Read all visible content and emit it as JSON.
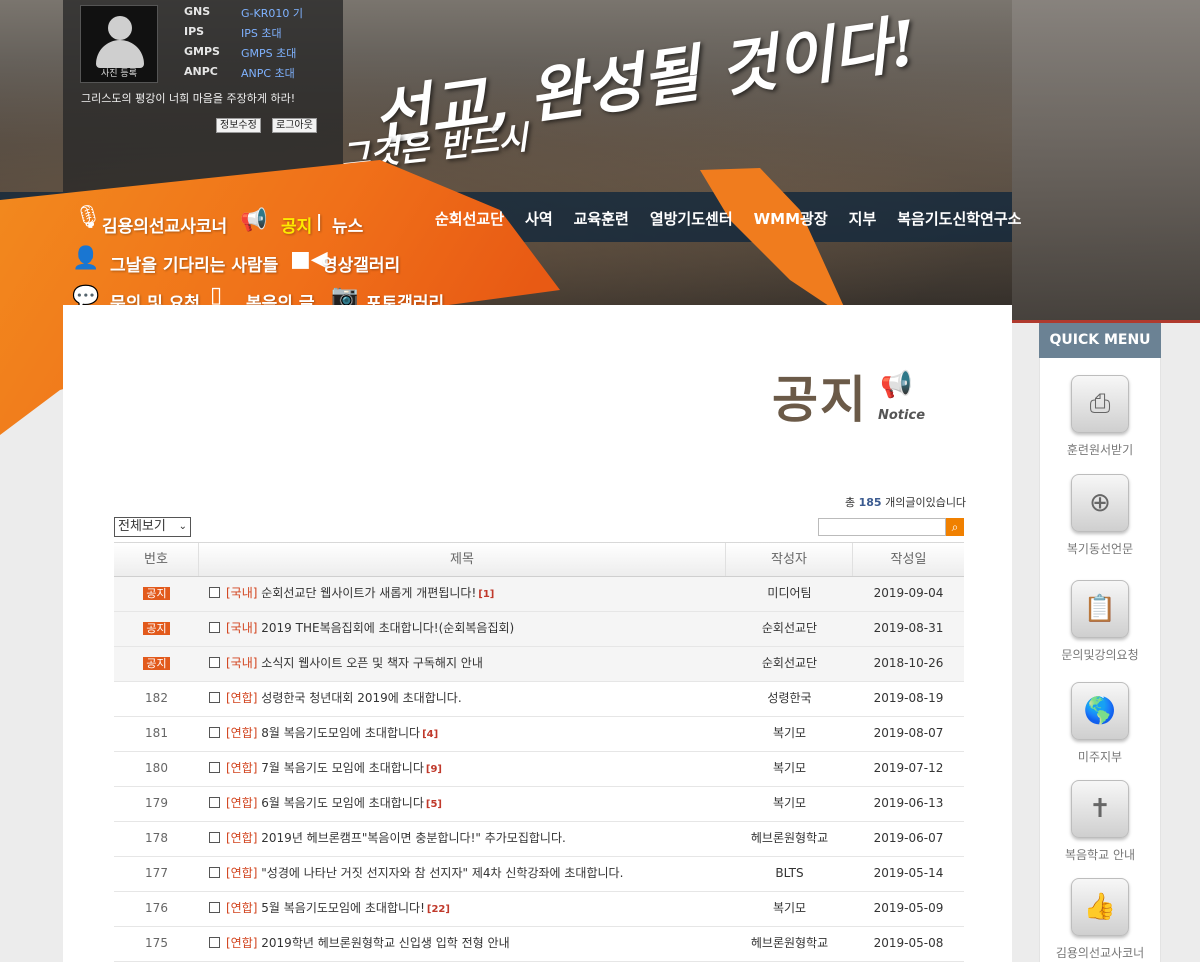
{
  "login": {
    "photo_caption": "사진 등록",
    "rows": [
      {
        "label": "GNS",
        "value": "G-KR010 기"
      },
      {
        "label": "IPS",
        "value": "IPS 초대"
      },
      {
        "label": "GMPS",
        "value": "GMPS 초대"
      },
      {
        "label": "ANPC",
        "value": "ANPC 초대"
      }
    ],
    "motto": "그리스도의 평강이 너희 마음을 주장하게 하라!",
    "edit_label": "정보수정",
    "logout_label": "로그아웃"
  },
  "slogan": {
    "line1": "선교, 완성될 것이다!",
    "line2": "그것은 반드시"
  },
  "nav": [
    "순회선교단",
    "사역",
    "교육훈련",
    "열방기도센터",
    "WMM광장",
    "지부",
    "복음기도신학연구소"
  ],
  "quicklinks": {
    "missionary_corner": "김용의선교사코너",
    "notice": "공지",
    "separator": "|",
    "news": "뉴스",
    "waiting_people": "그날을 기다리는 사람들",
    "video_gallery": "영상갤러리",
    "inquiry": "문의 및 요청",
    "gospel_writing": "복음의 글",
    "photo_gallery": "포토갤러리"
  },
  "page_title": {
    "ko": "공지",
    "en": "Notice"
  },
  "count": {
    "prefix": "총",
    "value": "185",
    "suffix": "개의글이있습니다"
  },
  "filter": {
    "selected": "전체보기"
  },
  "table": {
    "headers": [
      "번호",
      "제목",
      "작성자",
      "작성일"
    ],
    "rows": [
      {
        "num": "공지",
        "notice": true,
        "cat": "[국내]",
        "title": "순회선교단 웹사이트가 새롭게 개편됩니다!",
        "comments": "[1]",
        "author": "미디어팀",
        "date": "2019-09-04"
      },
      {
        "num": "공지",
        "notice": true,
        "cat": "[국내]",
        "title": "2019 THE복음집회에 초대합니다!(순회복음집회)",
        "comments": "",
        "author": "순회선교단",
        "date": "2019-08-31"
      },
      {
        "num": "공지",
        "notice": true,
        "cat": "[국내]",
        "title": "소식지 웹사이트 오픈 및 책자 구독해지 안내",
        "comments": "",
        "author": "순회선교단",
        "date": "2018-10-26"
      },
      {
        "num": "182",
        "notice": false,
        "cat": "[연합]",
        "title": "성령한국 청년대회 2019에 초대합니다.",
        "comments": "",
        "author": "성령한국",
        "date": "2019-08-19"
      },
      {
        "num": "181",
        "notice": false,
        "cat": "[연합]",
        "title": "8월 복음기도모임에 초대합니다",
        "comments": "[4]",
        "author": "복기모",
        "date": "2019-08-07"
      },
      {
        "num": "180",
        "notice": false,
        "cat": "[연합]",
        "title": "7월 복음기도 모임에 초대합니다",
        "comments": "[9]",
        "author": "복기모",
        "date": "2019-07-12"
      },
      {
        "num": "179",
        "notice": false,
        "cat": "[연합]",
        "title": "6월 복음기도 모임에 초대합니다",
        "comments": "[5]",
        "author": "복기모",
        "date": "2019-06-13"
      },
      {
        "num": "178",
        "notice": false,
        "cat": "[연합]",
        "title": "2019년 헤브론캠프\"복음이면 충분합니다!\" 추가모집합니다.",
        "comments": "",
        "author": "헤브론원형학교",
        "date": "2019-06-07"
      },
      {
        "num": "177",
        "notice": false,
        "cat": "[연합]",
        "title": "\"성경에 나타난 거짓 선지자와 참 선지자\" 제4차 신학강좌에 초대합니다.",
        "comments": "",
        "author": "BLTS",
        "date": "2019-05-14"
      },
      {
        "num": "176",
        "notice": false,
        "cat": "[연합]",
        "title": "5월 복음기도모임에 초대합니다!",
        "comments": "[22]",
        "author": "복기모",
        "date": "2019-05-09"
      },
      {
        "num": "175",
        "notice": false,
        "cat": "[연합]",
        "title": "2019학년 헤브론원형학교 신입생 입학 전형 안내",
        "comments": "",
        "author": "헤브론원형학교",
        "date": "2019-05-08"
      }
    ]
  },
  "quick_menu": {
    "title": "QUICK MENU",
    "items": [
      {
        "label": "훈련원서받기",
        "icon": "fax-icon"
      },
      {
        "label": "복기동선언문",
        "icon": "steering-wheel-icon"
      },
      {
        "label": "문의및강의요청",
        "icon": "clipboard-icon"
      },
      {
        "label": "미주지부",
        "icon": "globe-icon"
      },
      {
        "label": "복음학교 안내",
        "icon": "cross-icon"
      },
      {
        "label": "김용의선교사코너",
        "icon": "thumbs-up-icon"
      }
    ]
  },
  "colors": {
    "accent_orange": "#f07c1e",
    "notice_badge": "#e25a1c",
    "category_red": "#d2441e",
    "quick_menu_head": "#6b8294"
  }
}
